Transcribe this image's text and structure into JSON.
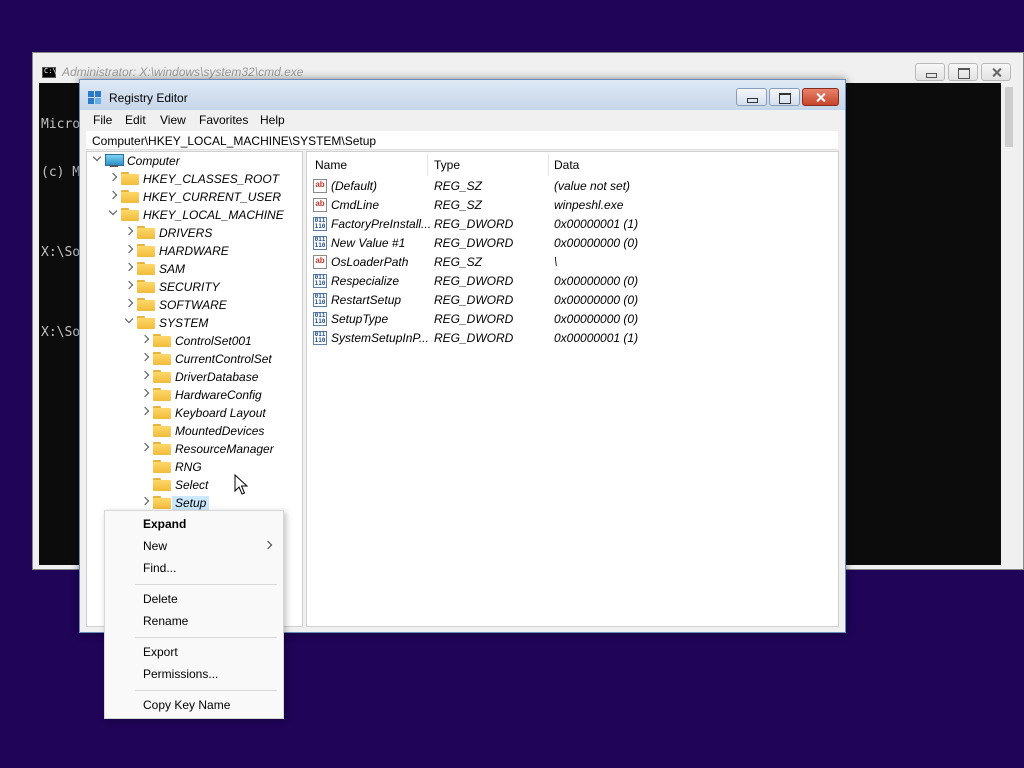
{
  "cmd": {
    "title": "Administrator: X:\\windows\\system32\\cmd.exe",
    "lines": [
      "Micro",
      "(c) M",
      "",
      "X:\\So",
      "",
      "X:\\So"
    ]
  },
  "regedit": {
    "title": "Registry Editor",
    "menu": [
      "File",
      "Edit",
      "View",
      "Favorites",
      "Help"
    ],
    "address": "Computer\\HKEY_LOCAL_MACHINE\\SYSTEM\\Setup",
    "tree": [
      {
        "label": "Computer",
        "level": 0,
        "expander": "down",
        "icon": "computer-icon"
      },
      {
        "label": "HKEY_CLASSES_ROOT",
        "level": 1,
        "expander": "right",
        "icon": "folder-icon"
      },
      {
        "label": "HKEY_CURRENT_USER",
        "level": 1,
        "expander": "right",
        "icon": "folder-icon"
      },
      {
        "label": "HKEY_LOCAL_MACHINE",
        "level": 1,
        "expander": "down",
        "icon": "folder-icon"
      },
      {
        "label": "DRIVERS",
        "level": 2,
        "expander": "right",
        "icon": "folder-icon"
      },
      {
        "label": "HARDWARE",
        "level": 2,
        "expander": "right",
        "icon": "folder-icon"
      },
      {
        "label": "SAM",
        "level": 2,
        "expander": "right",
        "icon": "folder-icon"
      },
      {
        "label": "SECURITY",
        "level": 2,
        "expander": "right",
        "icon": "folder-icon"
      },
      {
        "label": "SOFTWARE",
        "level": 2,
        "expander": "right",
        "icon": "folder-icon"
      },
      {
        "label": "SYSTEM",
        "level": 2,
        "expander": "down",
        "icon": "folder-icon"
      },
      {
        "label": "ControlSet001",
        "level": 3,
        "expander": "right",
        "icon": "folder-icon"
      },
      {
        "label": "CurrentControlSet",
        "level": 3,
        "expander": "right",
        "icon": "folder-icon"
      },
      {
        "label": "DriverDatabase",
        "level": 3,
        "expander": "right",
        "icon": "folder-icon"
      },
      {
        "label": "HardwareConfig",
        "level": 3,
        "expander": "right",
        "icon": "folder-icon"
      },
      {
        "label": "Keyboard Layout",
        "level": 3,
        "expander": "right",
        "icon": "folder-icon"
      },
      {
        "label": "MountedDevices",
        "level": 3,
        "expander": "none",
        "icon": "folder-icon"
      },
      {
        "label": "ResourceManager",
        "level": 3,
        "expander": "right",
        "icon": "folder-icon"
      },
      {
        "label": "RNG",
        "level": 3,
        "expander": "none",
        "icon": "folder-icon"
      },
      {
        "label": "Select",
        "level": 3,
        "expander": "none",
        "icon": "folder-icon"
      },
      {
        "label": "Setup",
        "level": 3,
        "expander": "right",
        "icon": "folder-icon",
        "selected": true
      }
    ],
    "columns": [
      "Name",
      "Type",
      "Data"
    ],
    "values": [
      {
        "name": "(Default)",
        "type": "REG_SZ",
        "data": "(value not set)",
        "icon": "string-value-icon"
      },
      {
        "name": "CmdLine",
        "type": "REG_SZ",
        "data": "winpeshl.exe",
        "icon": "string-value-icon"
      },
      {
        "name": "FactoryPreInstall...",
        "type": "REG_DWORD",
        "data": "0x00000001 (1)",
        "icon": "binary-value-icon"
      },
      {
        "name": "New Value #1",
        "type": "REG_DWORD",
        "data": "0x00000000 (0)",
        "icon": "binary-value-icon"
      },
      {
        "name": "OsLoaderPath",
        "type": "REG_SZ",
        "data": "\\",
        "icon": "string-value-icon"
      },
      {
        "name": "Respecialize",
        "type": "REG_DWORD",
        "data": "0x00000000 (0)",
        "icon": "binary-value-icon"
      },
      {
        "name": "RestartSetup",
        "type": "REG_DWORD",
        "data": "0x00000000 (0)",
        "icon": "binary-value-icon"
      },
      {
        "name": "SetupType",
        "type": "REG_DWORD",
        "data": "0x00000000 (0)",
        "icon": "binary-value-icon"
      },
      {
        "name": "SystemSetupInP...",
        "type": "REG_DWORD",
        "data": "0x00000001 (1)",
        "icon": "binary-value-icon"
      }
    ]
  },
  "context_menu": {
    "groups": [
      [
        "Expand",
        "New",
        "Find..."
      ],
      [
        "Delete",
        "Rename"
      ],
      [
        "Export",
        "Permissions..."
      ],
      [
        "Copy Key Name"
      ]
    ]
  },
  "colors": {
    "desktop": "#1f0458",
    "selection": "#cce8ff",
    "close_button": "#c7442a"
  }
}
